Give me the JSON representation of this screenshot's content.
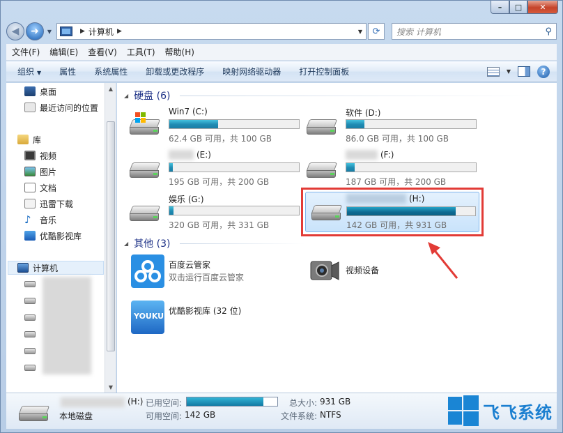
{
  "nav": {
    "address_crumb": "计算机",
    "search_placeholder": "搜索 计算机"
  },
  "menu": [
    "文件(F)",
    "编辑(E)",
    "查看(V)",
    "工具(T)",
    "帮助(H)"
  ],
  "commands": [
    "组织",
    "属性",
    "系统属性",
    "卸载或更改程序",
    "映射网络驱动器",
    "打开控制面板"
  ],
  "sidebar": {
    "favorites": [
      "桌面",
      "最近访问的位置"
    ],
    "library_head": "库",
    "libraries": [
      "视频",
      "图片",
      "文档",
      "迅雷下载",
      "音乐",
      "优酷影视库"
    ],
    "computer_head": "计算机"
  },
  "groups": {
    "hdd": "硬盘 (6)",
    "other": "其他 (3)"
  },
  "drives": [
    {
      "name": "Win7 (C:)",
      "info": "62.4 GB 可用，共 100 GB",
      "used_fraction": 0.376,
      "system": true
    },
    {
      "name": "软件 (D:)",
      "info": "86.0 GB 可用，共 100 GB",
      "used_fraction": 0.14
    },
    {
      "name": "(E:)",
      "info": "195 GB 可用，共 200 GB",
      "used_fraction": 0.025
    },
    {
      "name": "(F:)",
      "info": "187 GB 可用，共 200 GB",
      "used_fraction": 0.065
    },
    {
      "name": "娱乐 (G:)",
      "info": "320 GB 可用，共 331 GB",
      "used_fraction": 0.033
    },
    {
      "name": "(H:)",
      "info": "142 GB 可用，共 931 GB",
      "used_fraction": 0.847,
      "selected": true
    }
  ],
  "others": [
    {
      "name": "百度云管家",
      "sub": "双击运行百度云管家",
      "icon": "baidu-cloud-icon"
    },
    {
      "name": "视频设备",
      "icon": "video-camera-icon"
    },
    {
      "name": "优酷影视库 (32 位)",
      "icon": "youku-icon",
      "icon_text": "YOUKU"
    }
  ],
  "details": {
    "drive_label": "(H:)",
    "used_label": "已用空间:",
    "free_label": "可用空间:",
    "free_value": "142 GB",
    "total_label": "总大小:",
    "total_value": "931 GB",
    "fs_label": "文件系统:",
    "fs_value": "NTFS",
    "type": "本地磁盘",
    "used_fraction": 0.847
  },
  "watermark": "飞飞系统",
  "colors": {
    "accent": "#1e3287",
    "bar": "#1f8bb2",
    "highlight": "#e23b36"
  }
}
